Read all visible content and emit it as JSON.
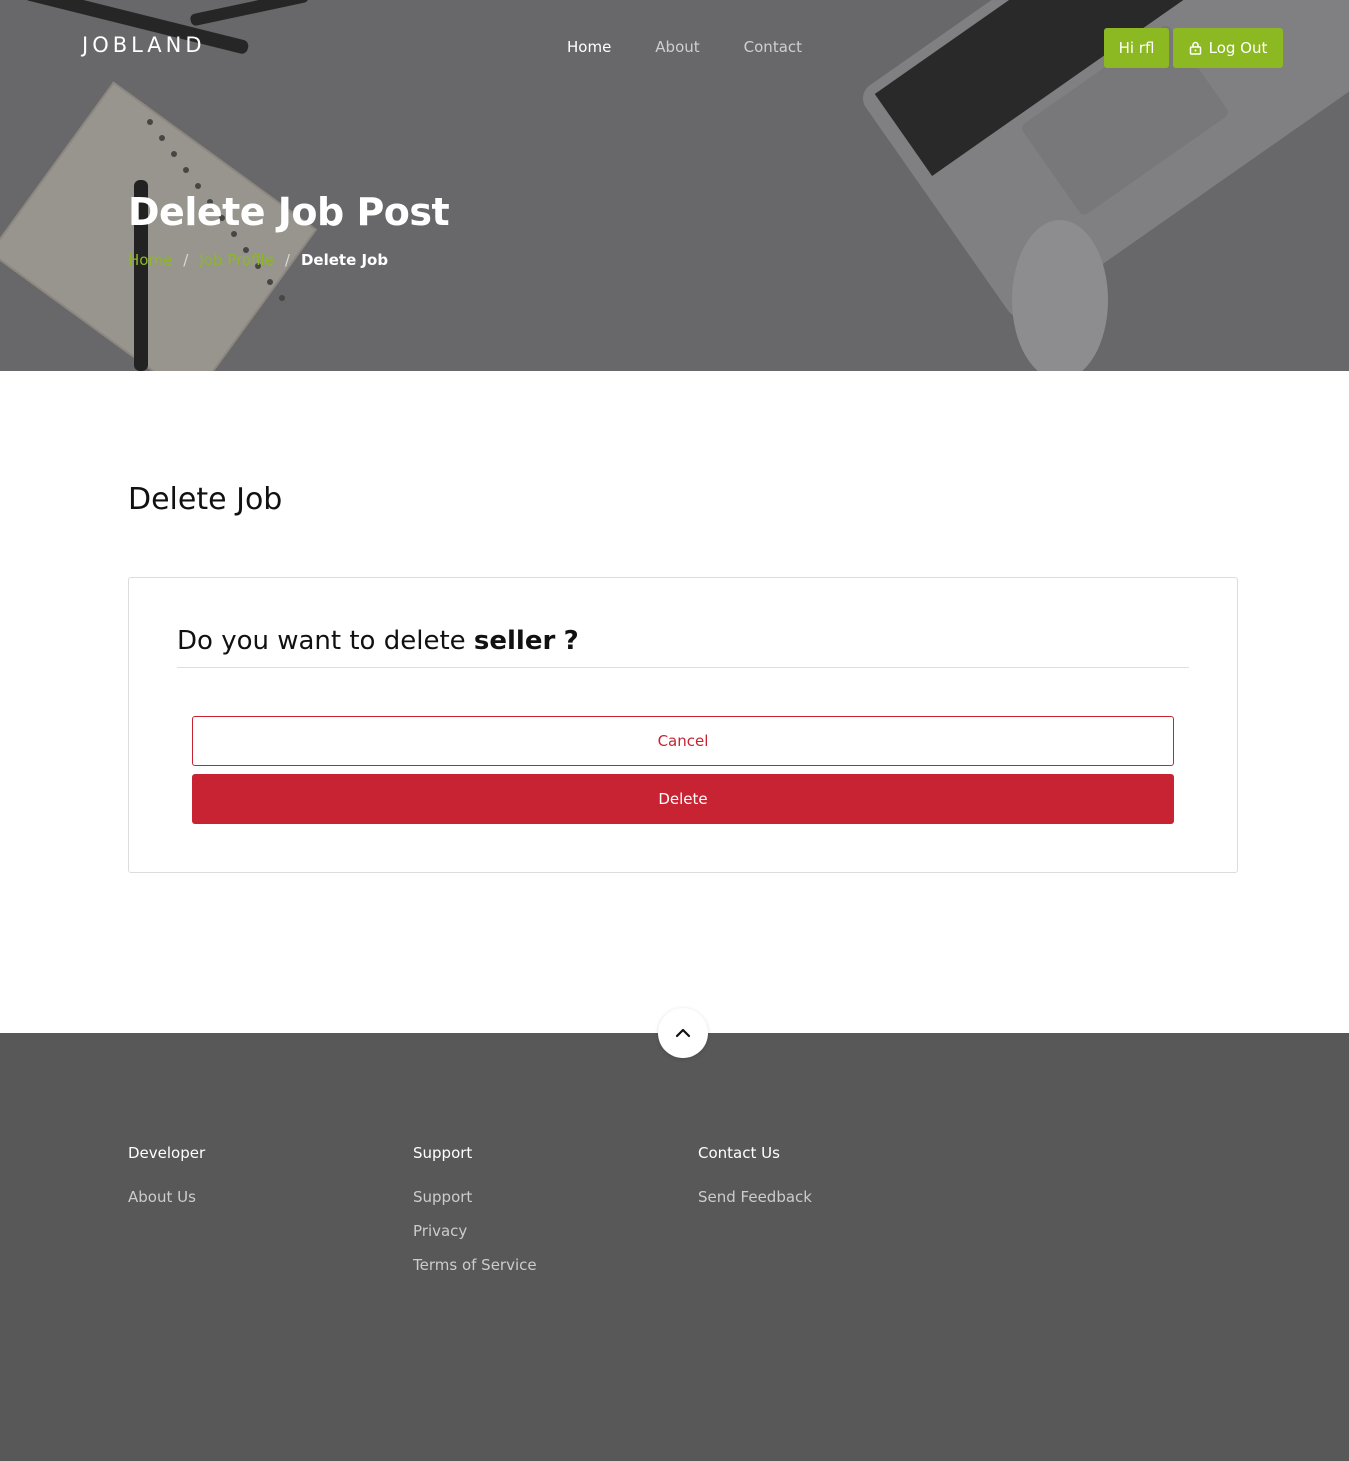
{
  "header": {
    "logo": "JOBLAND",
    "nav": [
      {
        "label": "Home",
        "active": true
      },
      {
        "label": "About",
        "active": false
      },
      {
        "label": "Contact",
        "active": false
      }
    ],
    "user_button": "Hi rfl",
    "logout_button": "Log Out"
  },
  "hero": {
    "title": "Delete Job Post",
    "breadcrumb": {
      "items": [
        "Home",
        "Job Profile"
      ],
      "separator": "/",
      "current": "Delete Job"
    }
  },
  "main": {
    "section_title": "Delete Job",
    "question_prefix": "Do you want to delete",
    "question_item": "seller",
    "question_suffix": "?",
    "cancel_label": "Cancel",
    "delete_label": "Delete"
  },
  "footer": {
    "columns": [
      {
        "title": "Developer",
        "links": [
          "About Us"
        ]
      },
      {
        "title": "Support",
        "links": [
          "Support",
          "Privacy",
          "Terms of Service"
        ]
      },
      {
        "title": "Contact Us",
        "links": [
          "Send Feedback"
        ]
      }
    ]
  },
  "colors": {
    "accent": "#8cb822",
    "danger": "#c82333",
    "footer_bg": "#585858"
  },
  "icons": {
    "lock": "lock-icon",
    "scroll_top": "chevron-up-icon"
  }
}
